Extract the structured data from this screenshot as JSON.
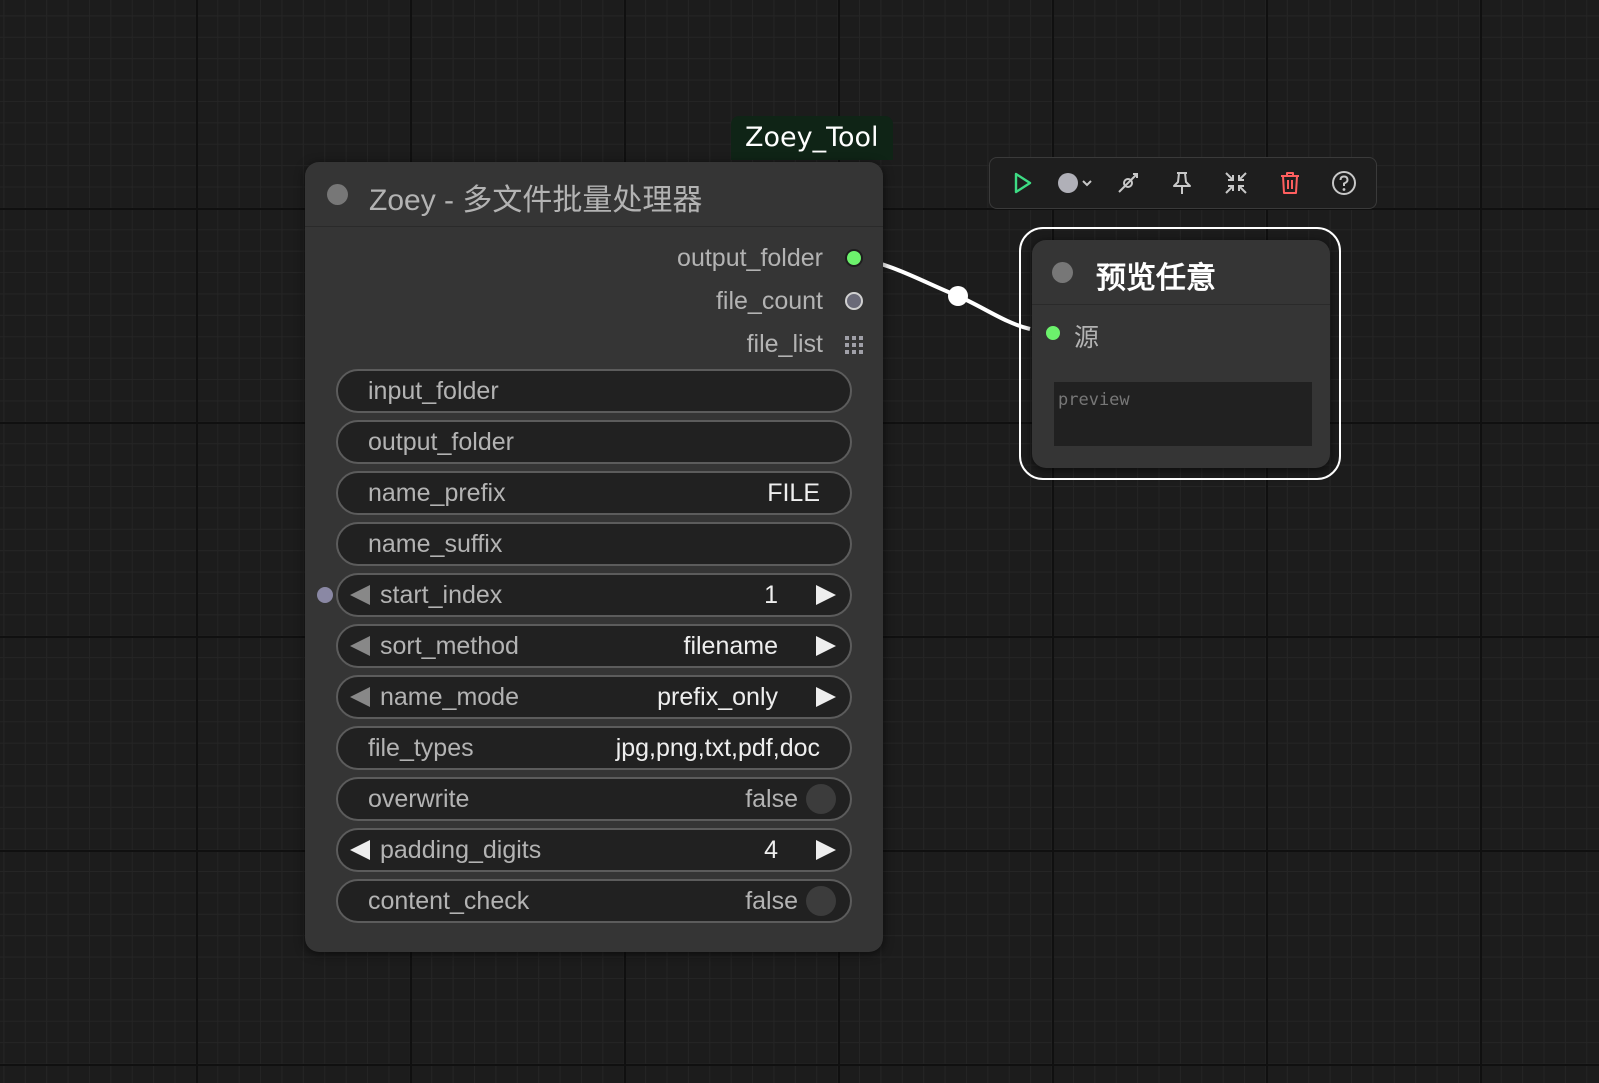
{
  "group": {
    "label": "Zoey_Tool"
  },
  "main_node": {
    "title": "Zoey - 多文件批量处理器",
    "outputs": [
      {
        "label": "output_folder",
        "slot_color": "#6cf26c"
      },
      {
        "label": "file_count",
        "slot_color": "#6a6a78"
      },
      {
        "label": "file_list",
        "slot_icon": "grid-icon"
      }
    ],
    "widgets": {
      "input_folder": {
        "label": "input_folder",
        "value": ""
      },
      "output_folder": {
        "label": "output_folder",
        "value": ""
      },
      "name_prefix": {
        "label": "name_prefix",
        "value": "FILE"
      },
      "name_suffix": {
        "label": "name_suffix",
        "value": ""
      },
      "start_index": {
        "label": "start_index",
        "value": "1"
      },
      "sort_method": {
        "label": "sort_method",
        "value": "filename"
      },
      "name_mode": {
        "label": "name_mode",
        "value": "prefix_only"
      },
      "file_types": {
        "label": "file_types",
        "value": "jpg,png,txt,pdf,doc"
      },
      "overwrite": {
        "label": "overwrite",
        "value": "false"
      },
      "padding_digits": {
        "label": "padding_digits",
        "value": "4"
      },
      "content_check": {
        "label": "content_check",
        "value": "false"
      }
    }
  },
  "toolbar": {
    "buttons": [
      {
        "icon": "play-icon",
        "color": "#3ddc84"
      },
      {
        "icon": "color-picker-icon",
        "color": "#b0b0b8"
      },
      {
        "icon": "bypass-icon",
        "color": "#c8c8c8"
      },
      {
        "icon": "pin-icon",
        "color": "#c8c8c8"
      },
      {
        "icon": "collapse-icon",
        "color": "#c8c8c8"
      },
      {
        "icon": "delete-icon",
        "color": "#ff5f5f"
      },
      {
        "icon": "help-icon",
        "color": "#c8c8c8"
      }
    ]
  },
  "preview_node": {
    "title": "预览任意",
    "input_label": "源",
    "preview_placeholder": "preview"
  },
  "colors": {
    "canvas": "#1c1c1c",
    "node_bg": "#353535",
    "widget_bg": "#212121",
    "link": "#ffffff",
    "slot_active": "#6cf26c"
  }
}
